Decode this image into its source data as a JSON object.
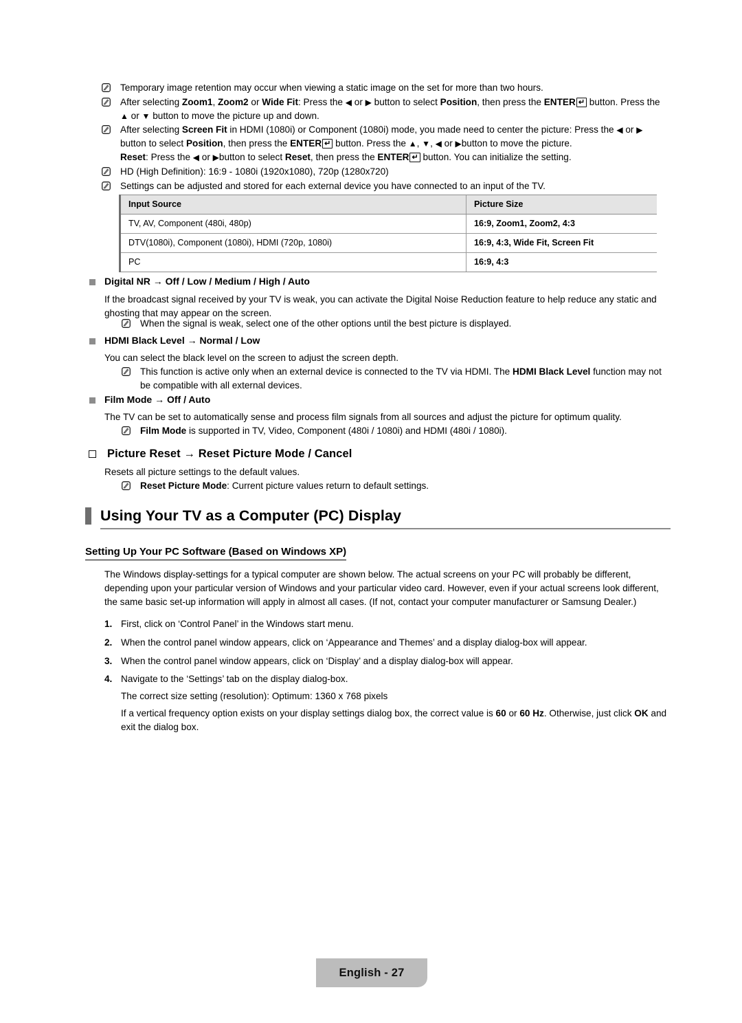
{
  "page": {
    "footer_label": "English - 27",
    "accent_gray": "#6e6e6e",
    "table_header_bg": "#e4e4e4",
    "footer_bg": "#bcbcbc"
  },
  "top_notes": [
    {
      "id": "note-image-retention",
      "text": "Temporary image retention may occur when viewing a static image on the set for more than two hours."
    },
    {
      "id": "note-zoom-position",
      "text": "After selecting Zoom1, Zoom2 or Wide Fit: Press the ◀ or ▶ button to select Position, then press the ENTER ⏎ button. Press the ▲ or ▼ button to move the picture up and down."
    },
    {
      "id": "note-screen-fit",
      "text": "After selecting Screen Fit in HDMI (1080i) or Component (1080i) mode, you made need to center the picture: Press the ◀ or ▶ button to select Position, then press the ENTER ⏎ button. Press the ▲, ▼, ◀ or ▶ button to move the picture. Reset: Press the ◀ or ▶ button to select Reset, then press the ENTER ⏎ button. You can initialize the setting."
    },
    {
      "id": "note-hd",
      "text": "HD (High Definition): 16:9 - 1080i (1920x1080), 720p (1280x720)"
    },
    {
      "id": "note-settings-stored",
      "text": "Settings can be adjusted and stored for each external device you have connected to an input of the TV."
    }
  ],
  "table": {
    "headers": [
      "Input Source",
      "Picture Size"
    ],
    "rows": [
      [
        "TV, AV, Component (480i, 480p)",
        "16:9, Zoom1, Zoom2, 4:3"
      ],
      [
        "DTV(1080i), Component (1080i), HDMI (720p, 1080i)",
        "16:9, 4:3, Wide Fit, Screen Fit"
      ],
      [
        "PC",
        "16:9, 4:3"
      ]
    ]
  },
  "digital_nr": {
    "heading": "Digital NR → Off / Low / Medium / High / Auto",
    "paragraph": "If the broadcast signal received by your TV is weak, you can activate the Digital Noise Reduction feature to help reduce any static and ghosting that may appear on the screen.",
    "note": "When the signal is weak, select one of the other options until the best picture is displayed."
  },
  "hdmi_black_level": {
    "heading": "HDMI Black Level → Normal / Low",
    "paragraph": "You can select the black level on the screen to adjust the screen depth.",
    "note": "This function is active only when an external device is connected to the TV via HDMI. The HDMI Black Level function may not be compatible with all external devices."
  },
  "film_mode": {
    "heading": "Film Mode → Off / Auto",
    "paragraph": "The TV can be set to automatically sense and process film signals from all sources and adjust the picture for optimum quality.",
    "note": "Film Mode is supported in TV, Video, Component (480i / 1080i) and HDMI (480i / 1080i)."
  },
  "picture_reset": {
    "heading": "Picture Reset → Reset Picture Mode / Cancel",
    "paragraph": "Resets all picture settings to the default values.",
    "note": "Reset Picture Mode: Current picture values return to default settings."
  },
  "section": {
    "title": "Using Your TV as a Computer (PC) Display",
    "subheading": "Setting Up Your PC Software (Based on Windows XP)",
    "intro": "The Windows display-settings for a typical computer are shown below. The actual screens on your PC will probably be different, depending upon your particular version of Windows and your particular video card. However, even if your actual screens look different, the same basic set-up information will apply in almost all cases. (If not, contact your computer manufacturer or Samsung Dealer.)",
    "steps": [
      {
        "num": "1.",
        "text": "First, click on ‘Control Panel’ in the Windows start menu.",
        "extra": []
      },
      {
        "num": "2.",
        "text": "When the control panel window appears, click on ‘Appearance and Themes’ and a display dialog-box will appear.",
        "extra": []
      },
      {
        "num": "3.",
        "text": "When the control panel window appears, click on ‘Display’ and a display dialog-box will appear.",
        "extra": []
      },
      {
        "num": "4.",
        "text": "Navigate to the ‘Settings’ tab on the display dialog-box.",
        "extra": [
          "The correct size setting (resolution): Optimum: 1360 x 768 pixels",
          "If a vertical frequency option exists on your display settings dialog box, the correct value is 60 or 60 Hz. Otherwise, just click OK and exit the dialog box."
        ]
      }
    ]
  }
}
